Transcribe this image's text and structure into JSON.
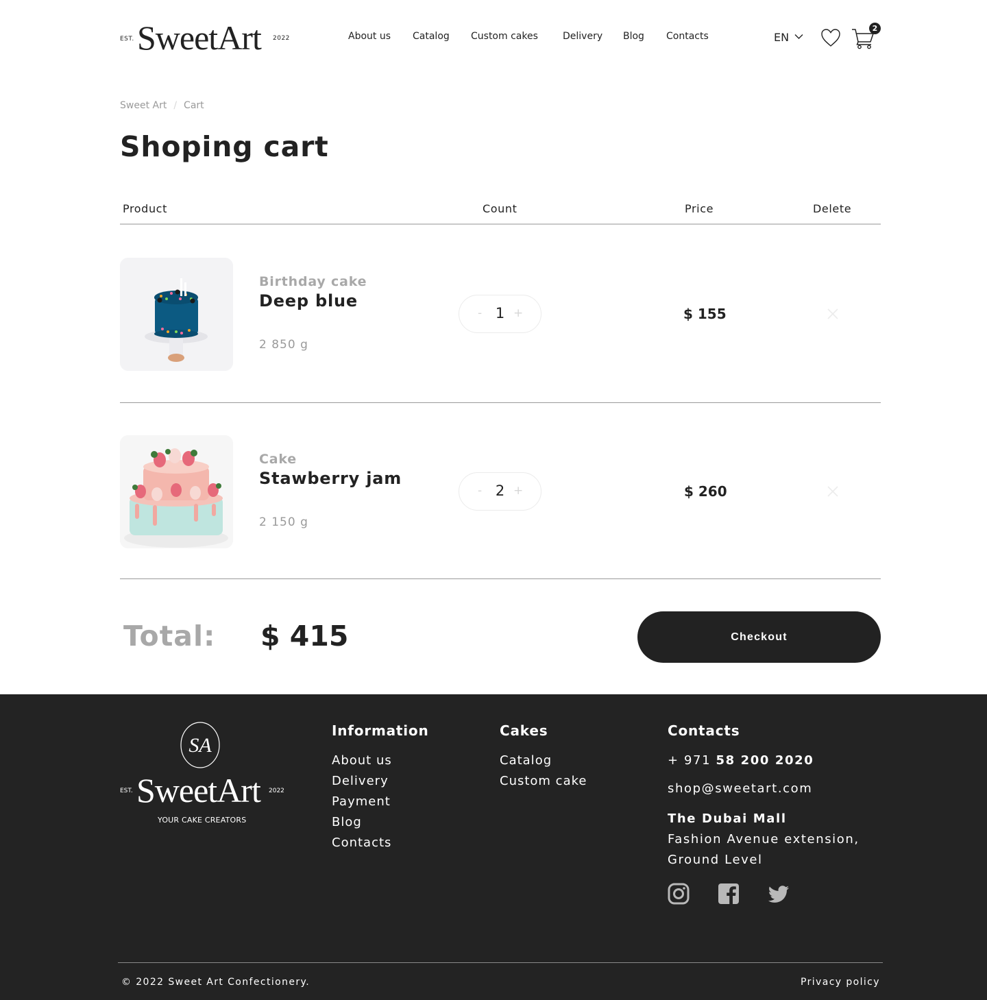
{
  "header": {
    "logo": {
      "est": "EST.",
      "brand": "SweetArt",
      "year": "2022"
    },
    "nav": [
      "About us",
      "Catalog",
      "Custom cakes",
      "Delivery",
      "Blog",
      "Contacts"
    ],
    "language": "EN",
    "cart_count": "2"
  },
  "breadcrumb": {
    "home": "Sweet Art",
    "current": "Cart"
  },
  "page_title": "Shoping cart",
  "table_headers": {
    "product": "Product",
    "count": "Count",
    "price": "Price",
    "delete": "Delete"
  },
  "items": [
    {
      "category": "Birthday cake",
      "name": "Deep blue",
      "weight": "2 850 g",
      "quantity": "1",
      "price": "$ 155",
      "minus": "-",
      "plus": "+"
    },
    {
      "category": "Cake",
      "name": "Stawberry jam",
      "weight": "2 150 g",
      "quantity": "2",
      "price": "$ 260",
      "minus": "-",
      "plus": "+"
    }
  ],
  "total": {
    "label": "Total:",
    "value": "$ 415"
  },
  "checkout_label": "Checkout",
  "footer": {
    "logo": {
      "est": "EST.",
      "brand": "SweetArt",
      "year": "2022",
      "monogram": "SA",
      "tagline": "YOUR CAKE CREATORS"
    },
    "information": {
      "title": "Information",
      "links": [
        "About us",
        "Delivery",
        "Payment",
        "Blog",
        "Contacts"
      ]
    },
    "cakes": {
      "title": "Cakes",
      "links": [
        "Catalog",
        "Custom cake"
      ]
    },
    "contacts": {
      "title": "Contacts",
      "phone_prefix": "+ 971",
      "phone_number": "58 200 2020",
      "email": "shop@sweetart.com",
      "location_name": "The Dubai Mall",
      "address_line1": "Fashion Avenue extension,",
      "address_line2": "Ground Level",
      "social": [
        "instagram-icon",
        "facebook-icon",
        "twitter-icon"
      ]
    },
    "copyright": "© 2022 Sweet Art Confectionery.",
    "privacy": "Privacy policy"
  },
  "colors": {
    "dark": "#222222",
    "muted": "#a8a8a8",
    "footer_bg": "#232323"
  }
}
